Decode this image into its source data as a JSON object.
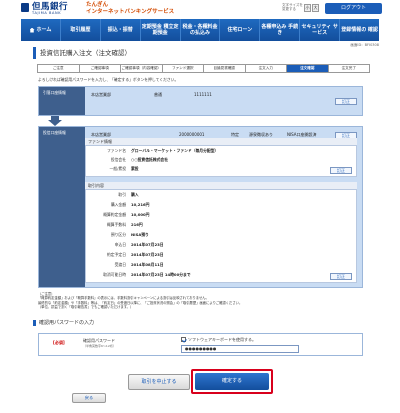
{
  "header": {
    "bank_name": "但馬銀行",
    "bank_en": "TAJIMA BANK",
    "service_line1": "たんぎん",
    "service_line2": "インターネットバンキングサービス",
    "font_size_label": "文字サイズを変更する",
    "font_size_small": "小",
    "font_size_large": "大",
    "logout": "ログアウト"
  },
  "nav": {
    "items": [
      "ホーム",
      "取引履歴",
      "振込・振替",
      "定期預金 積立定期預金",
      "税金・各種料金の払込み",
      "住宅ローン",
      "各種申込み 手続き",
      "セキュリティ サービス",
      "登録情報の 確認"
    ]
  },
  "breadcrumb": "画面ID：BFI0308",
  "page_title": "投資信託購入注文（注文確認）",
  "steps": [
    "ご注意",
    "ご確認事項",
    "ご確認事項（内容確認）",
    "ファンド選択",
    "目論見書確認",
    "注文入力",
    "注文確認",
    "注文完了"
  ],
  "active_step_index": 6,
  "instruction": "よろしければ確認用パスワードを入力し、「確定する」ボタンを押してください。",
  "withdraw_account": {
    "label": "引落口座情報",
    "branch": "本店営業部",
    "type": "普通",
    "number": "1111111",
    "edit": "訂正"
  },
  "invest_account": {
    "label": "投信口座情報",
    "branch": "本店営業部",
    "number": "2000000001",
    "kind": "特定",
    "tax": "源泉徴収あり",
    "nisa": "NISA口座開設済",
    "edit": "訂正"
  },
  "fund_info": {
    "heading": "ファンド情報",
    "rows": [
      {
        "label": "ファンド名",
        "value": "グローバル・マーケット・ファンド（毎月分配型）"
      },
      {
        "label": "投信会社",
        "value": "○○投資信託株式会社"
      },
      {
        "label": "一般/累投",
        "value": "累投"
      }
    ],
    "edit": "訂正"
  },
  "trade_info": {
    "heading": "取引内容",
    "rows": [
      {
        "label": "取引",
        "value": "購入"
      },
      {
        "label": "購入金額",
        "value": "10,216円"
      },
      {
        "label": "概算約定金額",
        "value": "10,000円"
      },
      {
        "label": "概算手数料",
        "value": "216円"
      },
      {
        "label": "預り区分",
        "value": "NISA預り"
      },
      {
        "label": "申込日",
        "value": "2014年07月23日"
      },
      {
        "label": "約定予定日",
        "value": "2014年07月23日"
      },
      {
        "label": "受渡日",
        "value": "2014年08月11日"
      },
      {
        "label": "取消可能日時",
        "value": "2014年07月23日 14時00分まで"
      }
    ],
    "edit": "訂正"
  },
  "notes": [
    "（ご注意）",
    "「概算約定金額」および「概算手数料」の表示には、手数料割引キャンペーンによる割引は反映されておりません。",
    "最終的な「約定金額」や「手数料」等は、「約定日」の受渡日以降に、「ご投資状況の照会」の「取引履歴」画面によりご確認ください。",
    "（単位、損益で割く「取引報告書」でもご確認いただけます。）"
  ],
  "password": {
    "heading": "確認用パスワードの入力",
    "required": "[必須]",
    "label": "確認用パスワード",
    "sub": "（半角英数字6〜12桁）",
    "software_keyboard": "ソフトウェアキーボードを使用する。",
    "value": "●●●●●●●●●"
  },
  "buttons": {
    "stop": "取引を中止する",
    "confirm": "確定する",
    "back": "戻る"
  },
  "colors": {
    "primary": "#1b5db8",
    "section_bg": "#c9dcf3",
    "section_label": "#3e5f8d",
    "highlight_border": "#d8001c"
  }
}
